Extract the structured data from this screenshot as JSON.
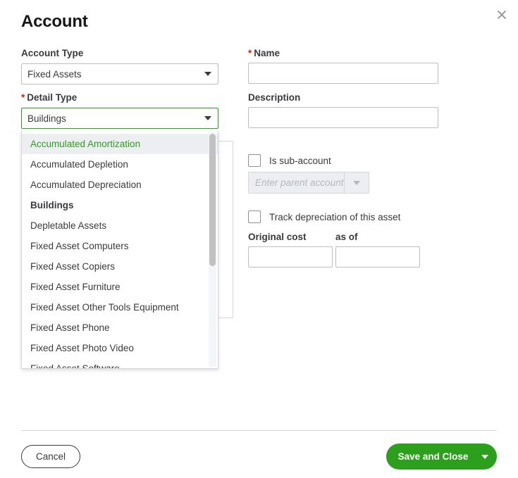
{
  "dialog": {
    "title": "Account",
    "close_icon": "close-icon"
  },
  "form": {
    "account_type": {
      "label": "Account Type",
      "value": "Fixed Assets",
      "required": false
    },
    "detail_type": {
      "label": "Detail Type",
      "value": "Buildings",
      "required": true,
      "required_marker": "*",
      "focused": true
    },
    "name": {
      "label": "Name",
      "value": "",
      "placeholder": "",
      "required": true,
      "required_marker": "*"
    },
    "description": {
      "label": "Description",
      "value": "",
      "placeholder": ""
    },
    "is_sub_account": {
      "label": "Is sub-account",
      "checked": false
    },
    "parent_account": {
      "placeholder": "Enter parent account",
      "value": "",
      "disabled": true
    },
    "track_depreciation": {
      "label": "Track depreciation of this asset",
      "checked": false
    },
    "original_cost": {
      "label": "Original cost",
      "value": "",
      "placeholder": ""
    },
    "as_of": {
      "label": "as of",
      "value": "",
      "placeholder": ""
    }
  },
  "detail_type_dropdown": {
    "open": true,
    "highlighted_index": 0,
    "current_value": "Buildings",
    "options": [
      "Accumulated Amortization",
      "Accumulated Depletion",
      "Accumulated Depreciation",
      "Buildings",
      "Depletable Assets",
      "Fixed Asset Computers",
      "Fixed Asset Copiers",
      "Fixed Asset Furniture",
      "Fixed Asset Other Tools Equipment",
      "Fixed Asset Phone",
      "Fixed Asset Photo Video",
      "Fixed Asset Software"
    ]
  },
  "footer": {
    "cancel_label": "Cancel",
    "save_label": "Save and Close",
    "save_dropdown_icon": "chevron-down-icon"
  },
  "colors": {
    "accent_green": "#2CA01C",
    "required_red": "#E01E00",
    "text_primary": "#393A3D",
    "border": "#BABEC5",
    "disabled_bg": "#ECEEF1"
  }
}
